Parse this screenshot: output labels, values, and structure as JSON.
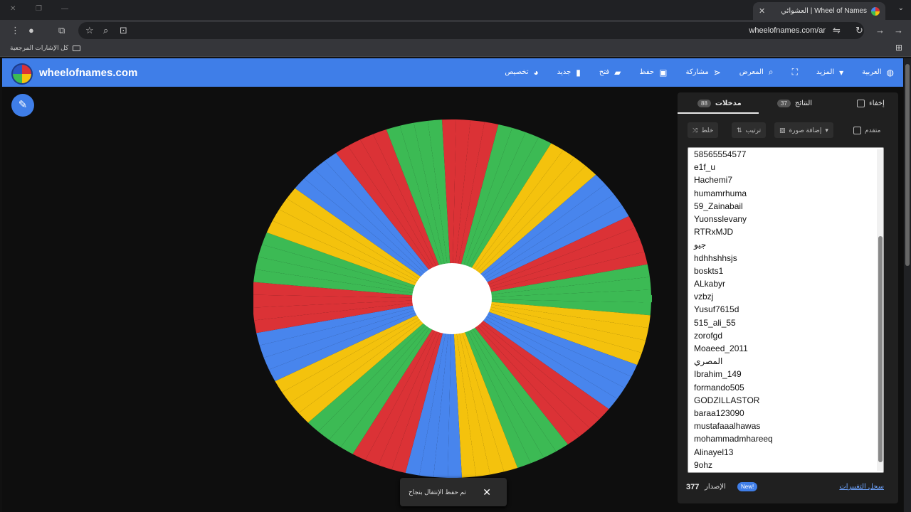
{
  "browser": {
    "tab_title": "Wheel of Names | العشوائي",
    "url": "wheelofnames.com/ar",
    "bookmarks_all": "كل الإشارات المرجعية"
  },
  "header": {
    "brand": "wheelofnames.com",
    "nav": [
      {
        "label": "العربية",
        "icon": "globe-icon"
      },
      {
        "label": "المزيد",
        "icon": "chevron-down-icon"
      },
      {
        "label": "",
        "icon": "fullscreen-icon"
      },
      {
        "label": "المعرض",
        "icon": "search-icon"
      },
      {
        "label": "مشاركة",
        "icon": "share-icon"
      },
      {
        "label": "حفظ",
        "icon": "save-icon"
      },
      {
        "label": "فتح",
        "icon": "folder-icon"
      },
      {
        "label": "جديد",
        "icon": "file-icon"
      },
      {
        "label": "تخصيص",
        "icon": "palette-icon"
      }
    ]
  },
  "panel": {
    "tab_entries_label": "مدخلات",
    "tab_entries_count": "88",
    "tab_results_label": "النتائج",
    "tab_results_count": "37",
    "hide_label": "إخفاء",
    "controls": {
      "shuffle": "خلط",
      "sort": "ترتيب",
      "add_image": "إضافة صورة",
      "advanced": "متقدم"
    },
    "entries": [
      "58565554577",
      "e1f_u",
      "Hachemi7",
      "humamrhuma",
      "59_Zainabail",
      "Yuonsslevany",
      "RTRxMJD",
      "جيو",
      "hdhhshhsjs",
      "boskts1",
      "ALkabyr",
      "vzbzj",
      "Yusuf7615d",
      "515_ali_55",
      "zorofgd",
      "Moaeed_2011",
      "المصري",
      "Ibrahim_149",
      "formando505",
      "GODZILLASTOR",
      "baraa123090",
      "mustafaaalhawas",
      "mohammadmhareeq",
      "Alinayel13",
      "9ohz"
    ],
    "footer": {
      "count": "377",
      "count_label": "الإصدار",
      "new_badge": "New!",
      "log_link": "سجل التغييرات"
    }
  },
  "toast": {
    "text": "تم حفظ الإنتقال بنجاح"
  },
  "colors": {
    "brand_blue": "#3f7ee8",
    "wheel": [
      "#db3236",
      "#3cba54",
      "#f4c20d",
      "#4885ed"
    ]
  }
}
